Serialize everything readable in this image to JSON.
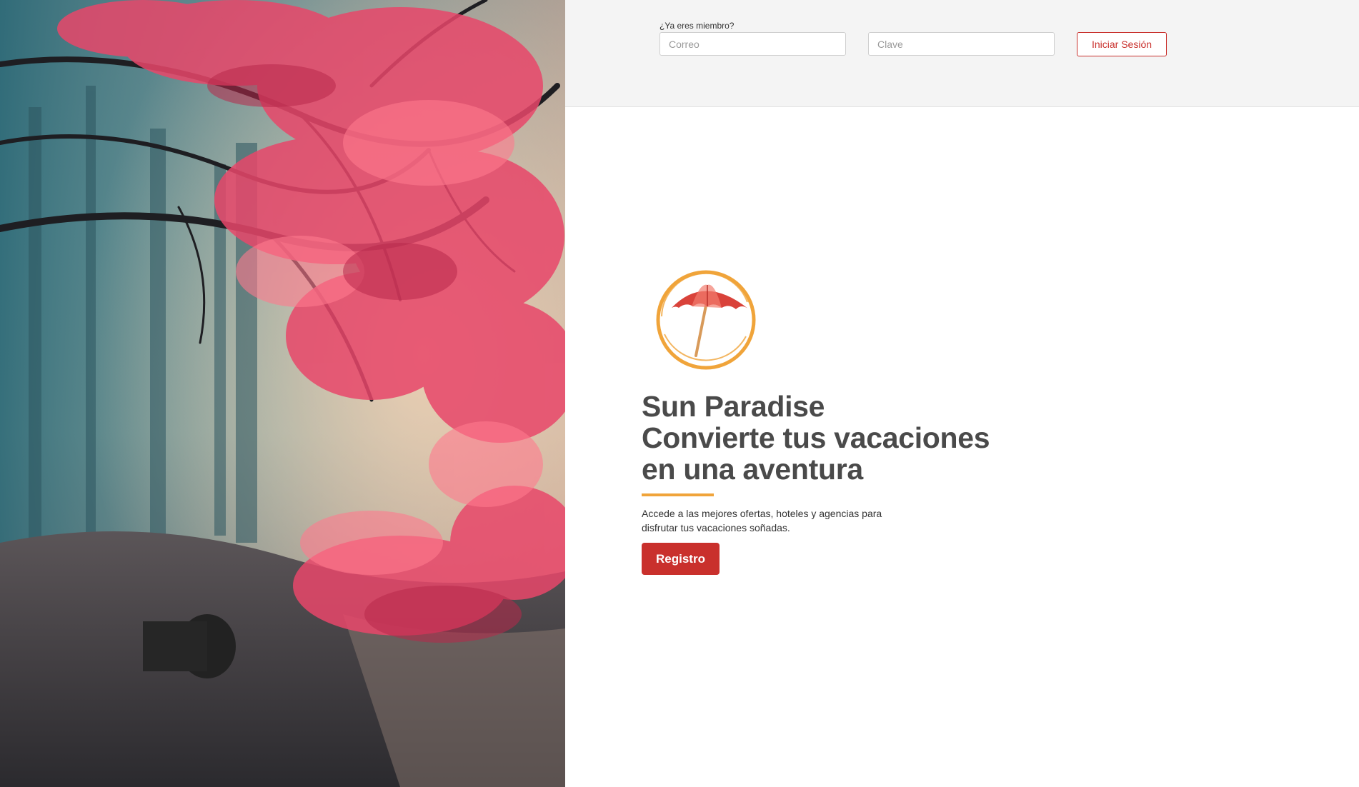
{
  "login": {
    "prompt": "¿Ya eres miembro?",
    "email_placeholder": "Correo",
    "password_placeholder": "Clave",
    "submit_label": "Iniciar Sesión"
  },
  "hero": {
    "title_line1": "Sun Paradise",
    "title_line2": "Convierte tus vacaciones",
    "title_line3": "en una aventura",
    "description": "Accede a las mejores ofertas, hoteles y agencias para disfrutar tus vacaciones soñadas.",
    "register_label": "Registro"
  },
  "colors": {
    "accent": "#c9302c",
    "underline": "#f0a43a",
    "logo_ring": "#f0a43a",
    "umbrella": "#d9423a"
  },
  "icons": {
    "logo": "beach-umbrella-icon"
  }
}
